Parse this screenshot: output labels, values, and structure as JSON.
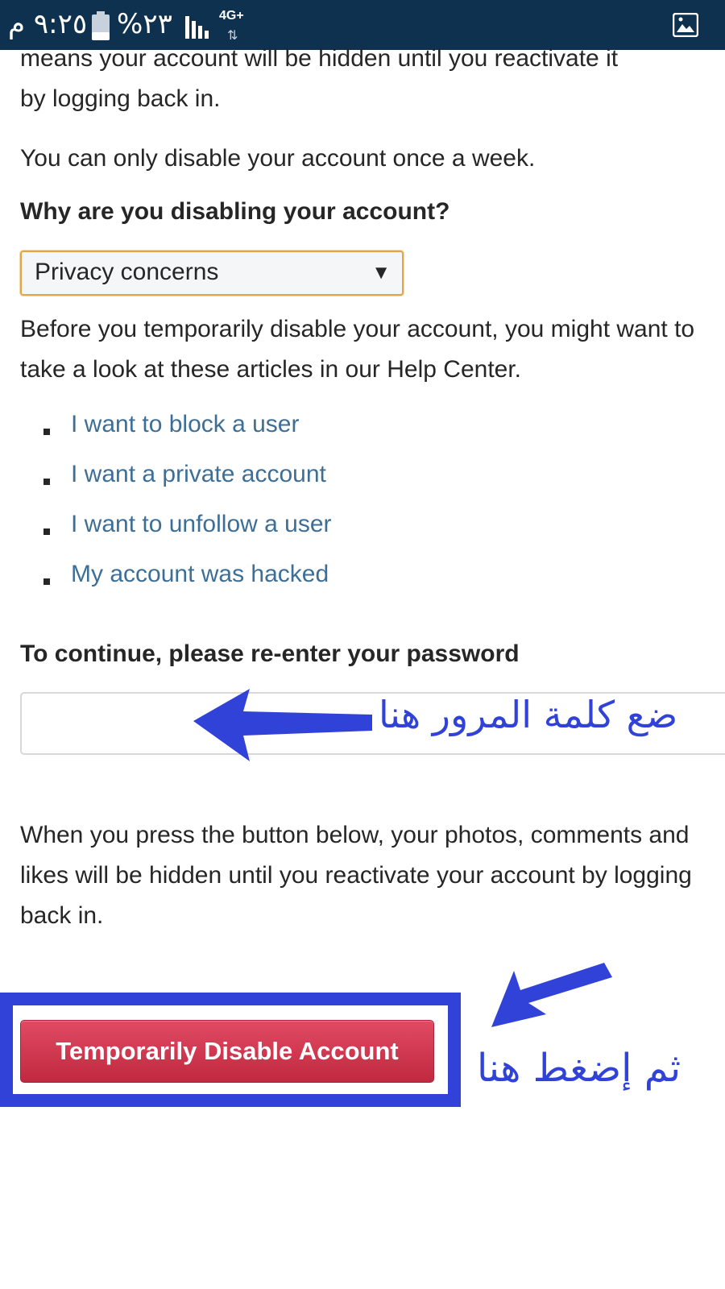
{
  "status_bar": {
    "time": "٩:٢٥ م",
    "battery": "%٢٣",
    "network": "4G+",
    "network_arrows": "⇅",
    "icons": [
      "battery-icon",
      "signal-icon",
      "gallery-icon"
    ]
  },
  "page": {
    "top_paragraph_line1": "means your account will be hidden until you reactivate it",
    "top_paragraph_line2": "by logging back in.",
    "once_a_week": "You can only disable your account once a week.",
    "reason_heading": "Why are you disabling your account?",
    "reason_select": {
      "selected": "Privacy concerns",
      "arrow": "▼"
    },
    "help_intro": "Before you temporarily disable your account, you might want to take a look at these articles in our Help Center.",
    "help_links": [
      "I want to block a user",
      "I want a private account",
      "I want to unfollow a user",
      "My account was hacked"
    ],
    "password_heading": "To continue, please re-enter your password",
    "password_value": "",
    "warning_text": "When you press the button below, your photos, comments and likes will be hidden until you reactivate your account by logging back in.",
    "disable_button": "Temporarily Disable Account"
  },
  "annotations": {
    "password_hint": "ضع كلمة المرور هنا",
    "button_hint": "ثم إضغط هنا",
    "color": "#3142d8"
  },
  "colors": {
    "status_bar": "#0f3150",
    "link": "#3d6f96",
    "button": "#d23a52",
    "select_border": "#e2a64a"
  }
}
